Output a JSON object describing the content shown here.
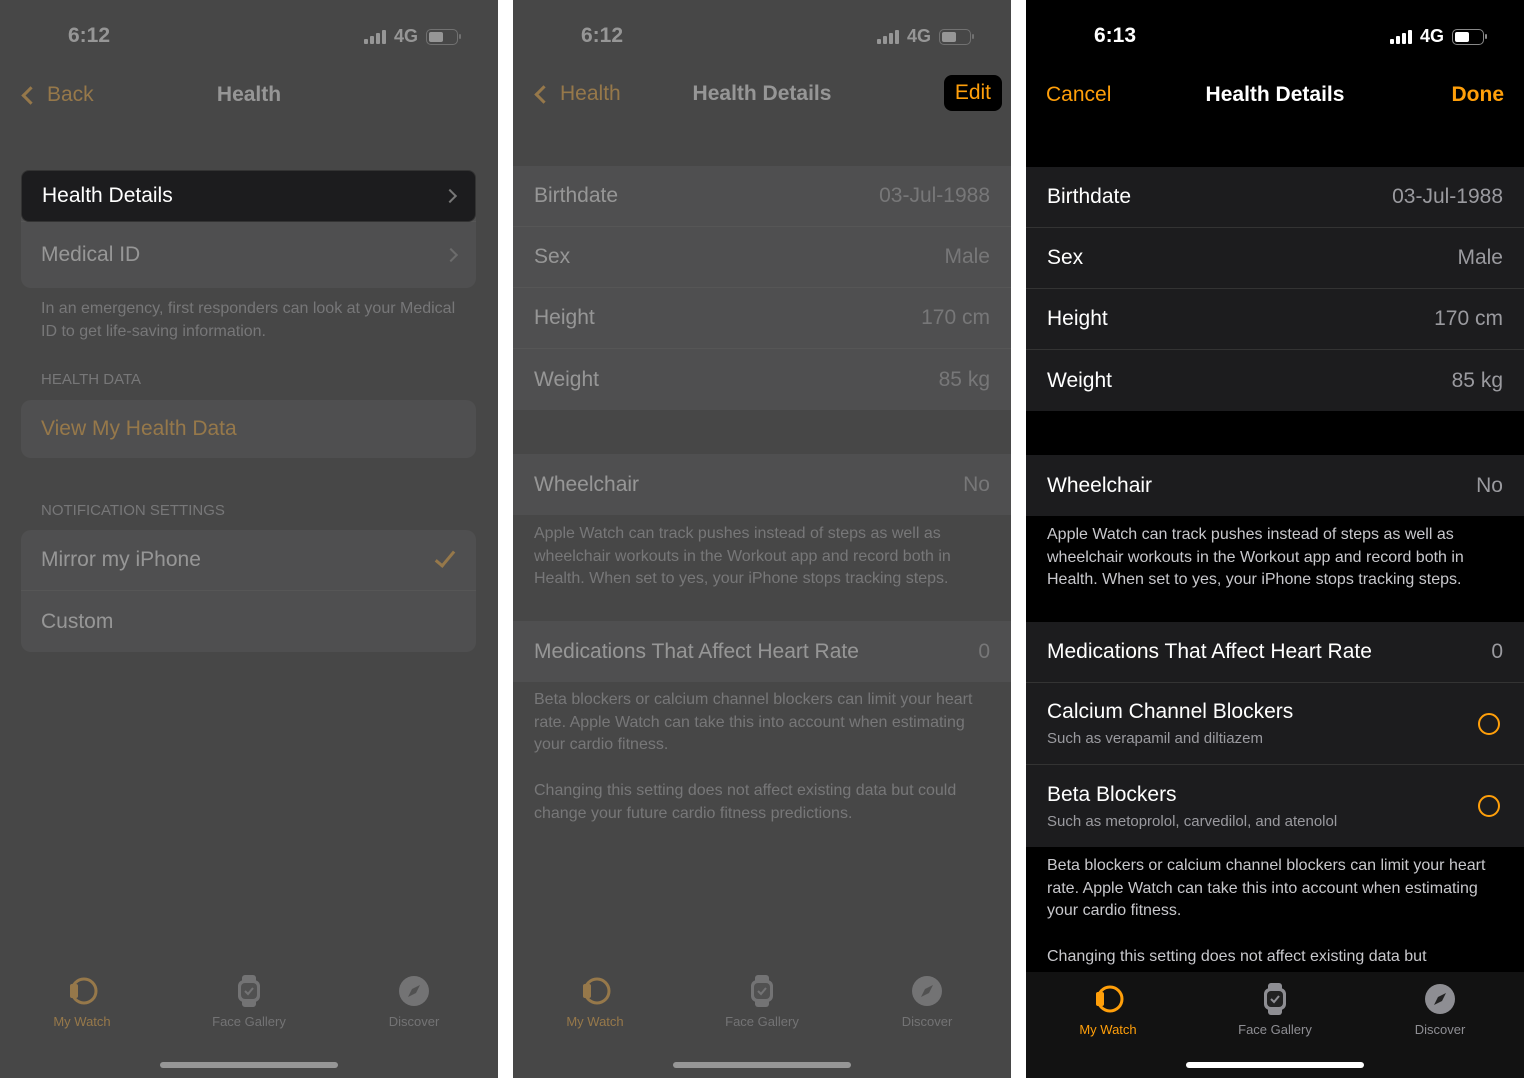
{
  "colors": {
    "accent": "#ff9f0a",
    "background": "#000000",
    "cell": "#1c1c1e",
    "secondary_text": "#9a9a9f"
  },
  "screen1": {
    "status": {
      "time": "6:12",
      "network": "4G"
    },
    "nav": {
      "back": "Back",
      "title": "Health"
    },
    "rows": [
      {
        "label": "Health Details"
      },
      {
        "label": "Medical ID"
      }
    ],
    "medical_footer": "In an emergency, first responders can look at your Medical ID to get life-saving information.",
    "health_data_header": "HEALTH DATA",
    "view_health_data": "View My Health Data",
    "notification_header": "NOTIFICATION SETTINGS",
    "notification_options": [
      {
        "label": "Mirror my iPhone",
        "selected": true
      },
      {
        "label": "Custom",
        "selected": false
      }
    ]
  },
  "screen2": {
    "status": {
      "time": "6:12",
      "network": "4G"
    },
    "nav": {
      "back": "Health",
      "title": "Health Details",
      "edit": "Edit"
    },
    "details": [
      {
        "label": "Birthdate",
        "value": "03-Jul-1988"
      },
      {
        "label": "Sex",
        "value": "Male"
      },
      {
        "label": "Height",
        "value": "170 cm"
      },
      {
        "label": "Weight",
        "value": "85 kg"
      }
    ],
    "wheelchair": {
      "label": "Wheelchair",
      "value": "No"
    },
    "wheelchair_footer": "Apple Watch can track pushes instead of steps as well as wheelchair workouts in the Workout app and record both in Health. When set to yes, your iPhone stops tracking steps.",
    "medications": {
      "label": "Medications That Affect Heart Rate",
      "value": "0"
    },
    "med_footer_1": "Beta blockers or calcium channel blockers can limit your heart rate. Apple Watch can take this into account when estimating your cardio fitness.",
    "med_footer_2": "Changing this setting does not affect existing data but could change your future cardio fitness predictions."
  },
  "screen3": {
    "status": {
      "time": "6:13",
      "network": "4G"
    },
    "nav": {
      "cancel": "Cancel",
      "title": "Health Details",
      "done": "Done"
    },
    "details": [
      {
        "label": "Birthdate",
        "value": "03-Jul-1988"
      },
      {
        "label": "Sex",
        "value": "Male"
      },
      {
        "label": "Height",
        "value": "170 cm"
      },
      {
        "label": "Weight",
        "value": "85 kg"
      }
    ],
    "wheelchair": {
      "label": "Wheelchair",
      "value": "No"
    },
    "wheelchair_footer": "Apple Watch can track pushes instead of steps as well as wheelchair workouts in the Workout app and record both in Health. When set to yes, your iPhone stops tracking steps.",
    "medications": {
      "label": "Medications That Affect Heart Rate",
      "value": "0"
    },
    "med_options": [
      {
        "label": "Calcium Channel Blockers",
        "sub": "Such as verapamil and diltiazem",
        "selected": false
      },
      {
        "label": "Beta Blockers",
        "sub": "Such as metoprolol, carvedilol, and atenolol",
        "selected": false
      }
    ],
    "med_footer_1": "Beta blockers or calcium channel blockers can limit your heart rate. Apple Watch can take this into account when estimating your cardio fitness.",
    "med_footer_2": "Changing this setting does not affect existing data but"
  },
  "tabs": [
    {
      "label": "My Watch",
      "icon": "watch-side-icon",
      "active": true
    },
    {
      "label": "Face Gallery",
      "icon": "watch-face-icon",
      "active": false
    },
    {
      "label": "Discover",
      "icon": "compass-icon",
      "active": false
    }
  ]
}
